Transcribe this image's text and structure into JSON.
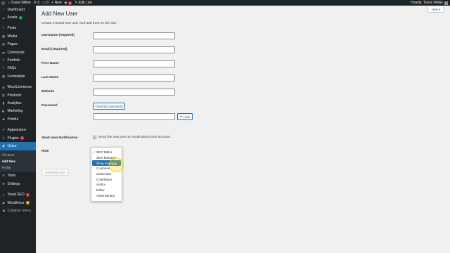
{
  "admin_bar": {
    "site_name": "Travis Wilkie",
    "updates_count": "2",
    "comments_count": "0",
    "new_label": "New",
    "notifications_count": "3",
    "edit_live_label": "Edit Live",
    "howdy": "Howdy, Travis Wilkie"
  },
  "sidebar": {
    "items": [
      {
        "label": "Dashboard",
        "icon": "dashboard-icon"
      },
      {
        "label": "Avada",
        "badge": "1",
        "badge_color": "#00a32a",
        "icon": "avada-icon"
      },
      {
        "label": "Posts",
        "icon": "posts-icon"
      },
      {
        "label": "Media",
        "icon": "media-icon"
      },
      {
        "label": "Pages",
        "icon": "pages-icon"
      },
      {
        "label": "Comments",
        "icon": "comments-icon"
      },
      {
        "label": "Portfolio",
        "icon": "portfolio-icon"
      },
      {
        "label": "FAQs",
        "icon": "faqs-icon"
      },
      {
        "label": "Formidable",
        "icon": "formidable-icon"
      },
      {
        "label": "WooCommerce",
        "icon": "woocommerce-icon"
      },
      {
        "label": "Products",
        "icon": "products-icon"
      },
      {
        "label": "Analytics",
        "icon": "analytics-icon"
      },
      {
        "label": "Marketing",
        "icon": "marketing-icon"
      },
      {
        "label": "Printful",
        "icon": "printful-icon"
      },
      {
        "label": "Appearance",
        "icon": "appearance-icon"
      },
      {
        "label": "Plugins",
        "badge": "2",
        "badge_color": "#d63638",
        "icon": "plugins-icon"
      },
      {
        "label": "Users",
        "icon": "users-icon",
        "current": true
      },
      {
        "label": "Tools",
        "icon": "tools-icon"
      },
      {
        "label": "Settings",
        "icon": "settings-icon"
      },
      {
        "label": "Yoast SEO",
        "badge": "1",
        "badge_color": "#d63638",
        "icon": "yoast-icon"
      },
      {
        "label": "Wordfence",
        "badge": "1",
        "badge_color": "#dba617",
        "icon": "wordfence-icon"
      },
      {
        "label": "Collapse menu",
        "icon": "collapse-icon"
      }
    ],
    "users_submenu": [
      "All Users",
      "Add New",
      "Profile"
    ]
  },
  "help_label": "Help",
  "page": {
    "title": "Add New User",
    "description": "Create a brand new user and add them to this site."
  },
  "form": {
    "username_label": "Username (required)",
    "email_label": "Email (required)",
    "first_name_label": "First Name",
    "last_name_label": "Last Name",
    "website_label": "Website",
    "password_label": "Password",
    "generate_password_label": "Generate password",
    "hide_label": "Hide",
    "notification_label": "Send User Notification",
    "notification_text": "Send the new user an email about their account.",
    "role_label": "Role",
    "submit_label": "Add New User"
  },
  "role_dropdown": {
    "selected": "SEO Editor",
    "highlighted": "Shop manager",
    "options": [
      "SEO Editor",
      "SEO Manager",
      "Shop manager",
      "Customer",
      "Subscriber",
      "Contributor",
      "Author",
      "Editor",
      "Administrator"
    ]
  },
  "colors": {
    "admin_dark": "#1d2327",
    "accent": "#2271b1",
    "background": "#f0f0f1"
  }
}
